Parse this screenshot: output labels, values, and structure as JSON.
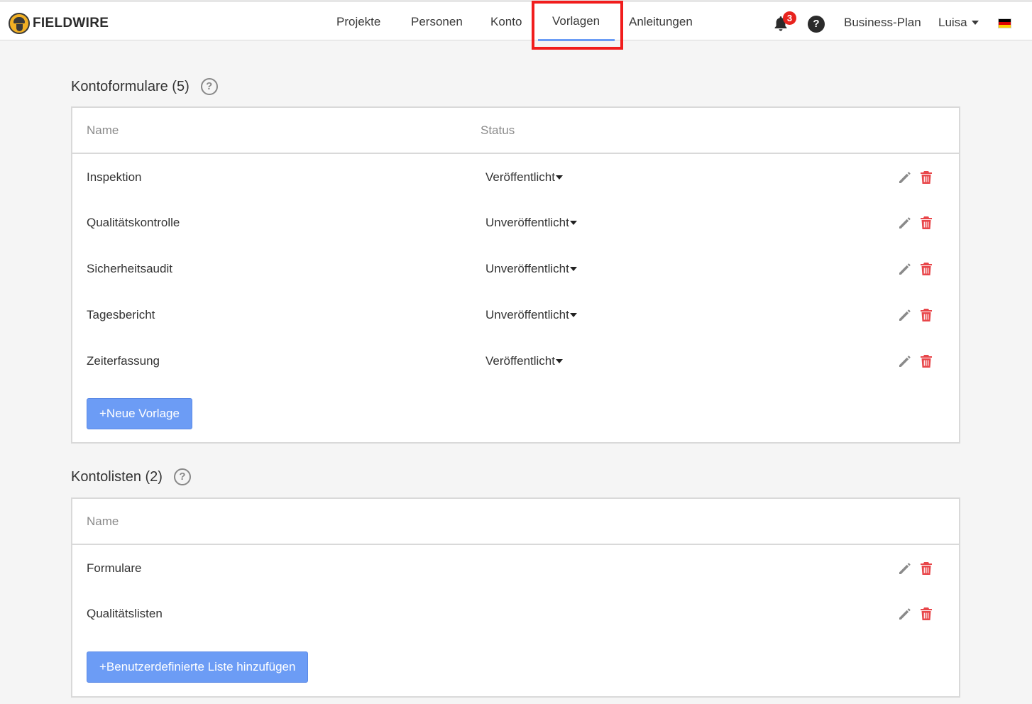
{
  "app": {
    "brand": "FIELDWIRE"
  },
  "nav": {
    "items": [
      {
        "label": "Projekte"
      },
      {
        "label": "Personen"
      },
      {
        "label": "Konto"
      },
      {
        "label": "Vorlagen",
        "active": true
      },
      {
        "label": "Anleitungen"
      }
    ]
  },
  "header_right": {
    "notifications_count": "3",
    "help_symbol": "?",
    "plan": "Business-Plan",
    "user": "Luisa",
    "language_flag": "de-flag-icon"
  },
  "forms_section": {
    "title": "Kontoformulare (5)",
    "help_symbol": "?",
    "columns": {
      "name": "Name",
      "status": "Status"
    },
    "rows": [
      {
        "name": "Inspektion",
        "status": "Veröffentlicht"
      },
      {
        "name": "Qualitätskontrolle",
        "status": "Unveröffentlicht"
      },
      {
        "name": "Sicherheitsaudit",
        "status": "Unveröffentlicht"
      },
      {
        "name": "Tagesbericht",
        "status": "Unveröffentlicht"
      },
      {
        "name": "Zeiterfassung",
        "status": "Veröffentlicht"
      }
    ],
    "add_button": "+Neue Vorlage"
  },
  "lists_section": {
    "title": "Kontolisten (2)",
    "help_symbol": "?",
    "columns": {
      "name": "Name"
    },
    "rows": [
      {
        "name": "Formulare"
      },
      {
        "name": "Qualitätslisten"
      }
    ],
    "add_button": "+Benutzerdefinierte Liste hinzufügen"
  },
  "colors": {
    "accent": "#6c9cf5",
    "highlight": "#f11d1d",
    "danger": "#e8464a",
    "badge": "#e8231e"
  }
}
